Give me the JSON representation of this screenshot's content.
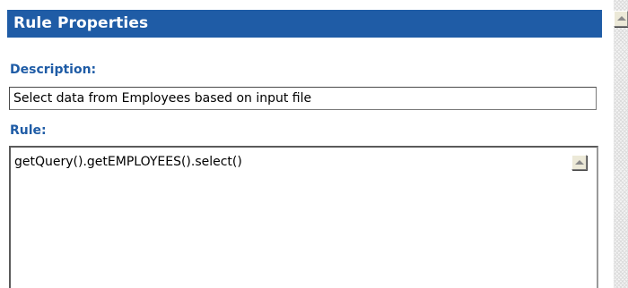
{
  "header": {
    "title": "Rule Properties"
  },
  "description": {
    "label": "Description:",
    "value": "Select data from Employees based on input file"
  },
  "rule": {
    "label": "Rule:",
    "value": "getQuery().getEMPLOYEES().select()"
  },
  "icons": {
    "rule_scroll_up": "arrow-up-icon",
    "panel_scroll_up": "arrow-up-icon"
  },
  "colors": {
    "title_bar_background": "#1f5ca6",
    "title_text": "#ffffff",
    "label_text": "#1f5ca6"
  }
}
